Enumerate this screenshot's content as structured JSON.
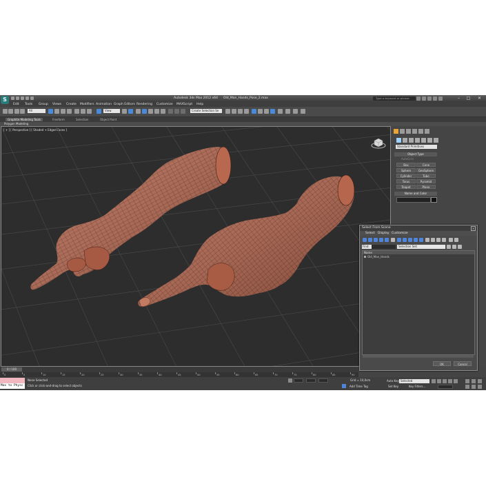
{
  "title": {
    "app": "Autodesk 3ds Max 2012 x64",
    "file": "Old_Man_Hands_Pose_2.max",
    "search_placeholder": "Type a keyword or phrase"
  },
  "menus": [
    "Edit",
    "Tools",
    "Group",
    "Views",
    "Create",
    "Modifiers",
    "Animation",
    "Graph Editors",
    "Rendering",
    "Customize",
    "MAXScript",
    "Help"
  ],
  "toolbar": {
    "selection_filter": "All",
    "ref_coord": "View",
    "named_selection": "Create Selection Se"
  },
  "ribbon": {
    "tabs": [
      "Graphite Modeling Tools",
      "Freeform",
      "Selection",
      "Object Paint"
    ],
    "sub": "Polygon Modeling"
  },
  "viewport": {
    "label": "[ + ] [ Perspective ] [ Shaded + Edged Faces ]"
  },
  "command_panel": {
    "category": "Standard Primitives",
    "object_type_title": "Object Type",
    "autogrid": "AutoGrid",
    "buttons": [
      "Box",
      "Cone",
      "Sphere",
      "GeoSphere",
      "Cylinder",
      "Tube",
      "Torus",
      "Pyramid",
      "Teapot",
      "Plane"
    ],
    "name_color_title": "Name and Color"
  },
  "dialog": {
    "title": "Select From Scene",
    "menus": [
      "Select",
      "Display",
      "Customize"
    ],
    "find_label": "Find:",
    "selection_set_label": "Selection Set:",
    "column_name": "Name",
    "items": [
      "Old_Man_Hands"
    ],
    "ok": "OK",
    "cancel": "Cancel"
  },
  "timeline": {
    "position": "0 / 100",
    "ticks": [
      "0",
      "5",
      "10",
      "15",
      "20",
      "25",
      "30",
      "35",
      "40",
      "45",
      "50",
      "55",
      "60",
      "65",
      "70",
      "75",
      "80",
      "85",
      "90"
    ]
  },
  "status": {
    "maxscript": "Max to Physc",
    "selection": "None Selected",
    "prompt": "Click or click-and-drag to select objects",
    "grid": "Grid = 10,0cm",
    "auto_key": "Auto Key",
    "auto_key_mode": "Selected",
    "set_key": "Set Key",
    "key_filters": "Key Filters...",
    "add_time_tag": "Add Time Tag"
  },
  "colors": {
    "skin": "#b4654d",
    "viewport_bg": "#2d2d2d",
    "accent": "#4f84d8"
  }
}
